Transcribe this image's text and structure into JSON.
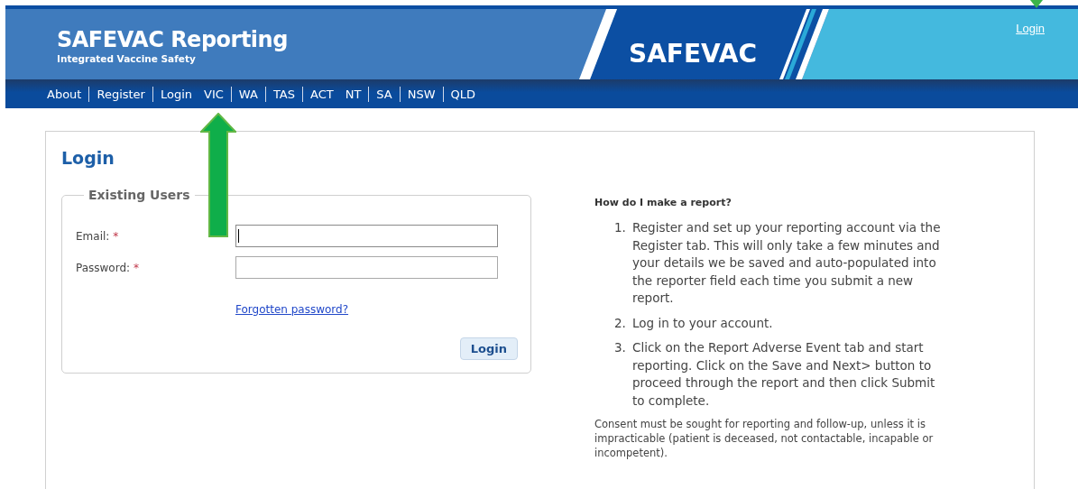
{
  "header": {
    "title": "SAFEVAC Reporting",
    "subtitle": "Integrated Vaccine Safety",
    "logo": "SAFEVAC",
    "login_link": "Login"
  },
  "nav_groups": [
    [
      "About",
      "Register",
      "Login"
    ],
    [
      "VIC",
      "WA",
      "TAS",
      "ACT"
    ],
    [
      "NT",
      "SA",
      "NSW",
      "QLD"
    ]
  ],
  "login": {
    "heading": "Login",
    "legend": "Existing Users",
    "fields": [
      {
        "label": "Email:",
        "required_mark": "*",
        "focused": true
      },
      {
        "label": "Password:",
        "required_mark": "*",
        "focused": false
      }
    ],
    "forgot_link": "Forgotten password?",
    "button": "Login"
  },
  "help": {
    "heading": "How do I make a report?",
    "steps": [
      {
        "number": "1.",
        "text": "Register and set up your reporting account via the Register tab. This will only take a few minutes and your details we be saved and auto-populated into the reporter field each time you submit a new report."
      },
      {
        "number": "2.",
        "text": "Log in to your account."
      },
      {
        "number": "3.",
        "text": "Click on the Report Adverse Event tab and start reporting. Click on the Save and Next> button to proceed through the report and then click Submit to complete."
      }
    ],
    "note": "Consent must be sought for reporting and follow-up, unless it is impracticable (patient is deceased, not contactable, incapable or incompetent)."
  }
}
